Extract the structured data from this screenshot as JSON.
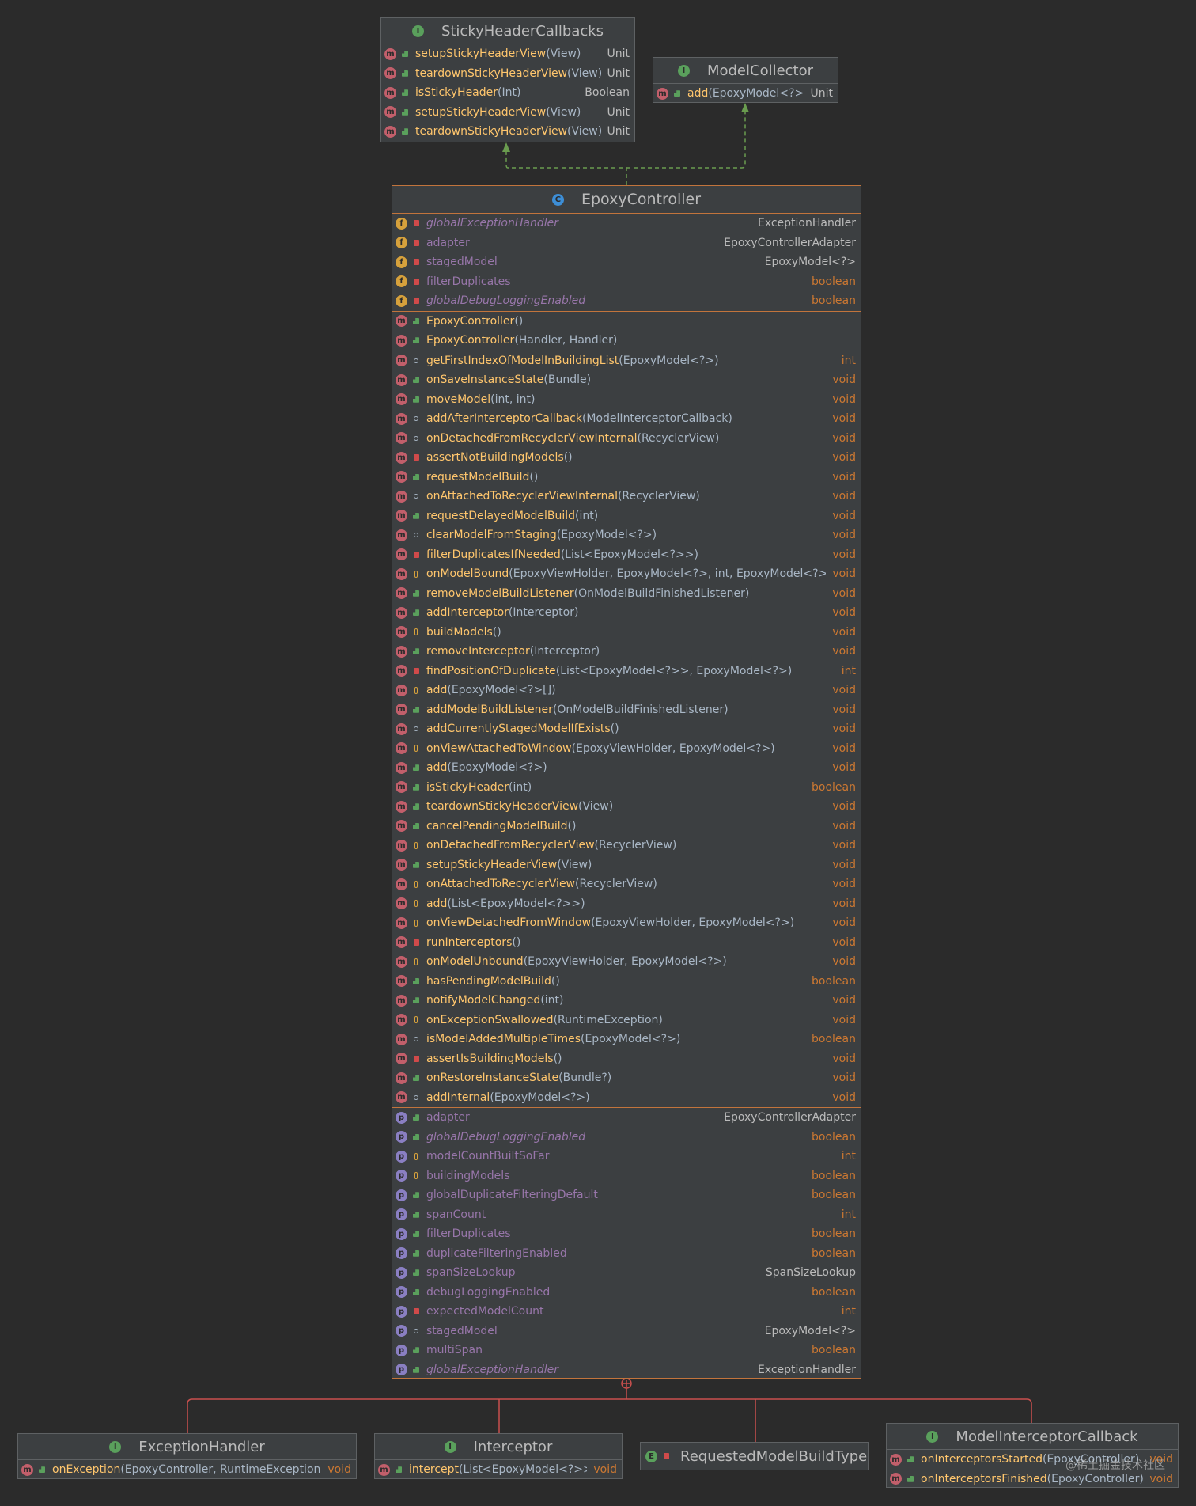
{
  "sticky": {
    "title": "StickyHeaderCallbacks",
    "members": [
      {
        "name": "setupStickyHeaderView",
        "params": "(View)",
        "ret": "Unit"
      },
      {
        "name": "teardownStickyHeaderView",
        "params": "(View)",
        "ret": "Unit"
      },
      {
        "name": "isStickyHeader",
        "params": "(Int)",
        "ret": "Boolean"
      },
      {
        "name": "setupStickyHeaderView",
        "params": "(View)",
        "ret": "Unit"
      },
      {
        "name": "teardownStickyHeaderView",
        "params": "(View)",
        "ret": "Unit"
      }
    ]
  },
  "collector": {
    "title": "ModelCollector",
    "members": [
      {
        "name": "add",
        "params": "(EpoxyModel<?>)",
        "ret": "Unit"
      }
    ]
  },
  "controller": {
    "title": "EpoxyController",
    "fields": [
      {
        "name": "globalExceptionHandler",
        "ret": "ExceptionHandler",
        "italic": true
      },
      {
        "name": "adapter",
        "ret": "EpoxyControllerAdapter"
      },
      {
        "name": "stagedModel",
        "ret": "EpoxyModel<?>"
      },
      {
        "name": "filterDuplicates",
        "ret": "boolean"
      },
      {
        "name": "globalDebugLoggingEnabled",
        "ret": "boolean",
        "italic": true
      }
    ],
    "constructors": [
      {
        "name": "EpoxyController",
        "params": "()"
      },
      {
        "name": "EpoxyController",
        "params": "(Handler, Handler)"
      }
    ],
    "methods": [
      {
        "name": "getFirstIndexOfModelInBuildingList",
        "params": "(EpoxyModel<?>)",
        "ret": "int"
      },
      {
        "name": "onSaveInstanceState",
        "params": "(Bundle)",
        "ret": "void"
      },
      {
        "name": "moveModel",
        "params": "(int, int)",
        "ret": "void"
      },
      {
        "name": "addAfterInterceptorCallback",
        "params": "(ModelInterceptorCallback)",
        "ret": "void"
      },
      {
        "name": "onDetachedFromRecyclerViewInternal",
        "params": "(RecyclerView)",
        "ret": "void"
      },
      {
        "name": "assertNotBuildingModels",
        "params": "()",
        "ret": "void"
      },
      {
        "name": "requestModelBuild",
        "params": "()",
        "ret": "void"
      },
      {
        "name": "onAttachedToRecyclerViewInternal",
        "params": "(RecyclerView)",
        "ret": "void"
      },
      {
        "name": "requestDelayedModelBuild",
        "params": "(int)",
        "ret": "void"
      },
      {
        "name": "clearModelFromStaging",
        "params": "(EpoxyModel<?>)",
        "ret": "void"
      },
      {
        "name": "filterDuplicatesIfNeeded",
        "params": "(List<EpoxyModel<?>>)",
        "ret": "void"
      },
      {
        "name": "onModelBound",
        "params": "(EpoxyViewHolder, EpoxyModel<?>, int, EpoxyModel<?>?)",
        "ret": "void"
      },
      {
        "name": "removeModelBuildListener",
        "params": "(OnModelBuildFinishedListener)",
        "ret": "void"
      },
      {
        "name": "addInterceptor",
        "params": "(Interceptor)",
        "ret": "void"
      },
      {
        "name": "buildModels",
        "params": "()",
        "ret": "void"
      },
      {
        "name": "removeInterceptor",
        "params": "(Interceptor)",
        "ret": "void"
      },
      {
        "name": "findPositionOfDuplicate",
        "params": "(List<EpoxyModel<?>>, EpoxyModel<?>)",
        "ret": "int"
      },
      {
        "name": "add",
        "params": "(EpoxyModel<?>[])",
        "ret": "void"
      },
      {
        "name": "addModelBuildListener",
        "params": "(OnModelBuildFinishedListener)",
        "ret": "void"
      },
      {
        "name": "addCurrentlyStagedModelIfExists",
        "params": "()",
        "ret": "void"
      },
      {
        "name": "onViewAttachedToWindow",
        "params": "(EpoxyViewHolder, EpoxyModel<?>)",
        "ret": "void"
      },
      {
        "name": "add",
        "params": "(EpoxyModel<?>)",
        "ret": "void"
      },
      {
        "name": "isStickyHeader",
        "params": "(int)",
        "ret": "boolean"
      },
      {
        "name": "teardownStickyHeaderView",
        "params": "(View)",
        "ret": "void"
      },
      {
        "name": "cancelPendingModelBuild",
        "params": "()",
        "ret": "void"
      },
      {
        "name": "onDetachedFromRecyclerView",
        "params": "(RecyclerView)",
        "ret": "void"
      },
      {
        "name": "setupStickyHeaderView",
        "params": "(View)",
        "ret": "void"
      },
      {
        "name": "onAttachedToRecyclerView",
        "params": "(RecyclerView)",
        "ret": "void"
      },
      {
        "name": "add",
        "params": "(List<EpoxyModel<?>>)",
        "ret": "void"
      },
      {
        "name": "onViewDetachedFromWindow",
        "params": "(EpoxyViewHolder, EpoxyModel<?>)",
        "ret": "void"
      },
      {
        "name": "runInterceptors",
        "params": "()",
        "ret": "void"
      },
      {
        "name": "onModelUnbound",
        "params": "(EpoxyViewHolder, EpoxyModel<?>)",
        "ret": "void"
      },
      {
        "name": "hasPendingModelBuild",
        "params": "()",
        "ret": "boolean"
      },
      {
        "name": "notifyModelChanged",
        "params": "(int)",
        "ret": "void"
      },
      {
        "name": "onExceptionSwallowed",
        "params": "(RuntimeException)",
        "ret": "void"
      },
      {
        "name": "isModelAddedMultipleTimes",
        "params": "(EpoxyModel<?>)",
        "ret": "boolean"
      },
      {
        "name": "assertIsBuildingModels",
        "params": "()",
        "ret": "void"
      },
      {
        "name": "onRestoreInstanceState",
        "params": "(Bundle?)",
        "ret": "void"
      },
      {
        "name": "addInternal",
        "params": "(EpoxyModel<?>)",
        "ret": "void"
      }
    ],
    "properties": [
      {
        "name": "adapter",
        "ret": "EpoxyControllerAdapter"
      },
      {
        "name": "globalDebugLoggingEnabled",
        "ret": "boolean",
        "italic": true
      },
      {
        "name": "modelCountBuiltSoFar",
        "ret": "int"
      },
      {
        "name": "buildingModels",
        "ret": "boolean"
      },
      {
        "name": "globalDuplicateFilteringDefault",
        "ret": "boolean"
      },
      {
        "name": "spanCount",
        "ret": "int"
      },
      {
        "name": "filterDuplicates",
        "ret": "boolean"
      },
      {
        "name": "duplicateFilteringEnabled",
        "ret": "boolean"
      },
      {
        "name": "spanSizeLookup",
        "ret": "SpanSizeLookup"
      },
      {
        "name": "debugLoggingEnabled",
        "ret": "boolean"
      },
      {
        "name": "expectedModelCount",
        "ret": "int"
      },
      {
        "name": "stagedModel",
        "ret": "EpoxyModel<?>"
      },
      {
        "name": "multiSpan",
        "ret": "boolean"
      },
      {
        "name": "globalExceptionHandler",
        "ret": "ExceptionHandler",
        "italic": true
      }
    ]
  },
  "exception_handler": {
    "title": "ExceptionHandler",
    "members": [
      {
        "name": "onException",
        "params": "(EpoxyController, RuntimeException)",
        "ret": "void"
      }
    ]
  },
  "interceptor": {
    "title": "Interceptor",
    "members": [
      {
        "name": "intercept",
        "params": "(List<EpoxyModel<?>>)",
        "ret": "void"
      }
    ]
  },
  "requested": {
    "title": "RequestedModelBuildType"
  },
  "mic": {
    "title": "ModelInterceptorCallback",
    "members": [
      {
        "name": "onInterceptorsStarted",
        "params": "(EpoxyController)",
        "ret": "void"
      },
      {
        "name": "onInterceptorsFinished",
        "params": "(EpoxyController)",
        "ret": "void"
      }
    ]
  },
  "watermark": "@稀土掘金技术社区"
}
